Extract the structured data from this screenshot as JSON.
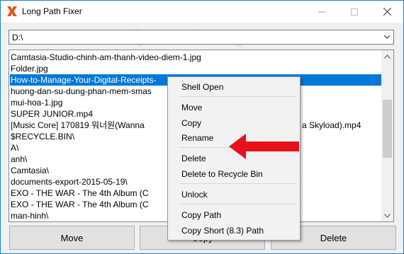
{
  "window": {
    "title": "Long Path Fixer"
  },
  "path": {
    "value": "D:\\"
  },
  "files": [
    {
      "name": "Camtasia-Studio-chinh-am-thanh-video-diem-1.jpg",
      "selected": false
    },
    {
      "name": "Folder.jpg",
      "selected": false
    },
    {
      "name": "How-to-Manage-Your-Digital-Receipts-",
      "selected": true
    },
    {
      "name": "huong-dan-su-dung-phan-mem-smas",
      "selected": false
    },
    {
      "name": "mui-hoa-1.jpg",
      "selected": false
    },
    {
      "name": "SUPER JUNIOR.mp4",
      "selected": false
    },
    {
      "name": "[Music Core] 170819 워너원(Wanna",
      "tail": "a Skyload).mp4",
      "selected": false
    },
    {
      "name": "$RECYCLE.BIN\\",
      "selected": false
    },
    {
      "name": "A\\",
      "selected": false
    },
    {
      "name": "anh\\",
      "selected": false
    },
    {
      "name": "Camtasia\\",
      "selected": false
    },
    {
      "name": "documents-export-2015-05-19\\",
      "selected": false
    },
    {
      "name": "EXO - THE WAR - The 4th Album (C",
      "selected": false
    },
    {
      "name": "EXO - THE WAR - The 4th Album (C",
      "selected": false
    },
    {
      "name": "man-hinh\\",
      "selected": false
    }
  ],
  "buttons": {
    "move": "Move",
    "copy": "Copy",
    "delete": "Delete"
  },
  "context_menu": {
    "items": [
      "Shell Open",
      "Move",
      "Copy",
      "Rename",
      "Delete",
      "Delete to Recycle Bin",
      "Unlock",
      "Copy Path",
      "Copy Short (8.3) Path"
    ]
  },
  "watermark": "Quantrimang",
  "colors": {
    "selection": "#0078d7",
    "arrow": "#e8111a",
    "title_icon": "#e8521a"
  }
}
